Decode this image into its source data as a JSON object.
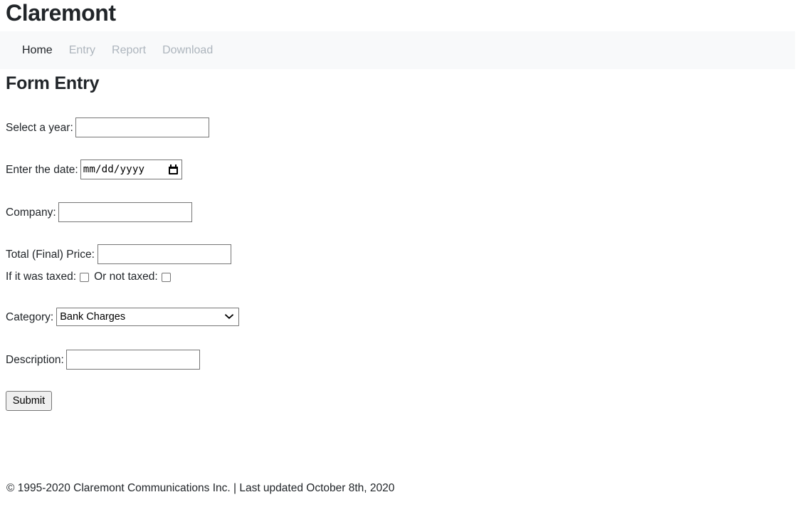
{
  "site": {
    "title": "Claremont"
  },
  "nav": {
    "items": [
      {
        "label": "Home",
        "active": true
      },
      {
        "label": "Entry",
        "active": false
      },
      {
        "label": "Report",
        "active": false
      },
      {
        "label": "Download",
        "active": false
      }
    ]
  },
  "page": {
    "heading": "Form Entry"
  },
  "form": {
    "year": {
      "label": "Select a year:",
      "value": "",
      "placeholder": ""
    },
    "date": {
      "label": "Enter the date:",
      "value": "",
      "placeholder": "mm/dd/yyyy",
      "icon": "calendar-icon"
    },
    "company": {
      "label": "Company:",
      "value": "",
      "placeholder": ""
    },
    "price": {
      "label": "Total (Final) Price:",
      "value": "",
      "placeholder": ""
    },
    "taxed": {
      "label": "If it was taxed:",
      "checked": false
    },
    "not_taxed": {
      "label": "Or not taxed:",
      "checked": false
    },
    "category": {
      "label": "Category:",
      "selected": "Bank Charges",
      "options": [
        "Bank Charges"
      ],
      "icon": "chevron-down-icon"
    },
    "description": {
      "label": "Description:",
      "value": "",
      "placeholder": ""
    },
    "submit": {
      "label": "Submit"
    }
  },
  "footer": {
    "text": "© 1995-2020 Claremont Communications Inc. | Last updated October 8th, 2020"
  },
  "colors": {
    "navbar_bg": "#f8f9fa",
    "text": "#212529",
    "muted_link": "#adb5bd",
    "input_border": "#767676",
    "button_bg": "#efefef"
  }
}
